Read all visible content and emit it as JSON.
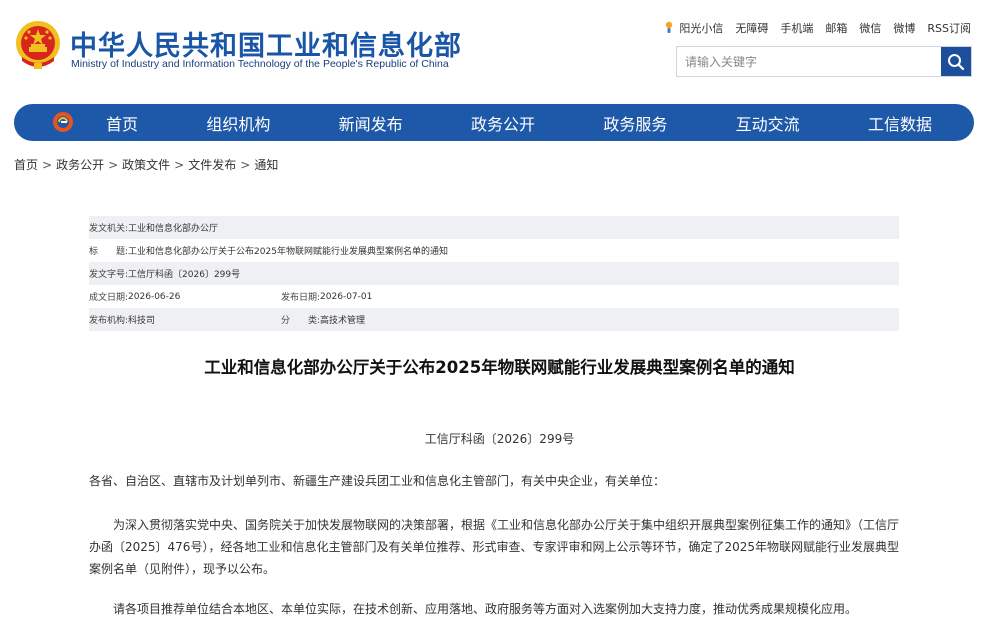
{
  "header": {
    "title": "中华人民共和国工业和信息化部",
    "subtitle": "Ministry of Industry and Information Technology of the People's Republic of China",
    "emblem_icon": "national-emblem-icon",
    "toplinks": [
      "阳光小信",
      "无障碍",
      "手机端",
      "邮箱",
      "微信",
      "微博",
      "RSS订阅"
    ],
    "search": {
      "placeholder": "请输入关键字",
      "value": ""
    }
  },
  "nav": {
    "items": [
      "首页",
      "组织机构",
      "新闻发布",
      "政务公开",
      "政务服务",
      "互动交流",
      "工信数据"
    ]
  },
  "breadcrumb": [
    "首页",
    "政务公开",
    "政策文件",
    "文件发布",
    "通知"
  ],
  "info": {
    "issuer_label": "发文机关:",
    "issuer": "工业和信息化部办公厅",
    "title_label": "标　　题:",
    "title": "工业和信息化部办公厅关于公布2025年物联网赋能行业发展典型案例名单的通知",
    "docno_label": "发文字号:",
    "docno": "工信厅科函〔2026〕299号",
    "written_label": "成文日期:",
    "written": "2026-06-26",
    "published_label": "发布日期:",
    "published": "2026-07-01",
    "org_label": "发布机构:",
    "org": "科技司",
    "category_label": "分　　类:",
    "category": "高技术管理"
  },
  "article": {
    "title": "工业和信息化部办公厅关于公布2025年物联网赋能行业发展典型案例名单的通知",
    "doc_number": "工信厅科函〔2026〕299号",
    "salutation": "各省、自治区、直辖市及计划单列市、新疆生产建设兵团工业和信息化主管部门，有关中央企业，有关单位：",
    "para1": "为深入贯彻落实党中央、国务院关于加快发展物联网的决策部署，根据《工业和信息化部办公厅关于集中组织开展典型案例征集工作的通知》（工信厅办函〔2025〕476号），经各地工业和信息化主管部门及有关单位推荐、形式审查、专家评审和网上公示等环节，确定了2025年物联网赋能行业发展典型案例名单（见附件），现予以公布。",
    "para2": "请各项目推荐单位结合本地区、本单位实际，在技术创新、应用落地、政府服务等方面对入选案例加大支持力度，推动优秀成果规模化应用。"
  },
  "colors": {
    "brand_blue": "#1e58a8",
    "title_blue": "#1a56a8",
    "search_button": "#1b4f9c",
    "emblem_red": "#d7261e",
    "emblem_gold": "#f2c01e",
    "info_shade": "#eef0f4"
  }
}
